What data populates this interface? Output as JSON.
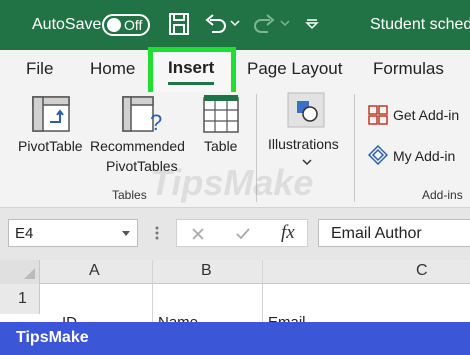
{
  "titlebar": {
    "autosave_label": "AutoSave",
    "autosave_state": "Off",
    "document_title": "Student sched"
  },
  "tabs": [
    "File",
    "Home",
    "Insert",
    "Page Layout",
    "Formulas"
  ],
  "active_tab": "Insert",
  "ribbon": {
    "pivottable": "PivotTable",
    "recommended_line1": "Recommended",
    "recommended_line2": "PivotTables",
    "table": "Table",
    "tables_group": "Tables",
    "illustrations": "Illustrations",
    "get_addins": "Get Add-in",
    "my_addins": "My Add-in",
    "addins_group": "Add-ins"
  },
  "formula_bar": {
    "name_box": "E4",
    "fx": "fx",
    "value": "Email Author"
  },
  "grid": {
    "columns": [
      "A",
      "B",
      "C"
    ],
    "row_numbers": [
      "1"
    ],
    "partial_cells": [
      "ID",
      "Name",
      "Email"
    ]
  },
  "watermark": "TipsMake",
  "footer": {
    "brand": "TipsMake"
  },
  "colors": {
    "titlebar": "#217346",
    "highlight": "#1fe030",
    "footer": "#3b56d6"
  }
}
